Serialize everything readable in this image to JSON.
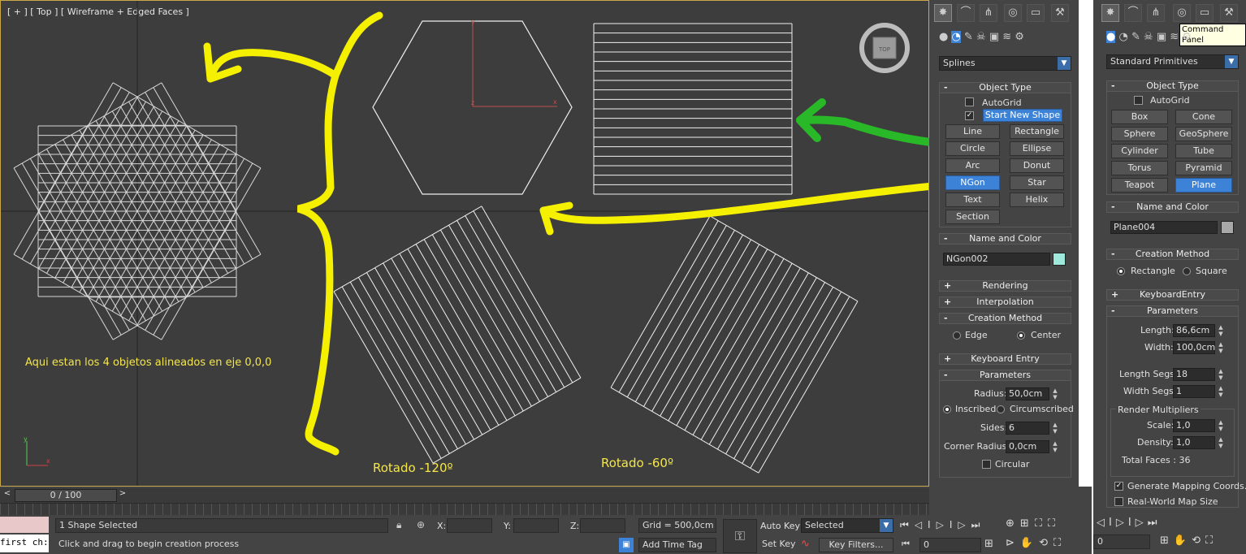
{
  "viewport": {
    "label": "[ + ] [ Top ] [ Wireframe + Edged Faces ]",
    "annotation_aligned": "Aqui estan los 4 objetos alineados en eje 0,0,0",
    "annotation_120": "Rotado -120º",
    "annotation_60": "Rotado -60º",
    "viewcube_label": "TOP",
    "axis_x": "x",
    "axis_y": "y",
    "pivot_x": "x",
    "pivot_y": "y",
    "pivot_z": "z"
  },
  "panel1": {
    "tool_icons": [
      "create-icon",
      "modify-icon",
      "hierarchy-icon",
      "motion-icon",
      "display-icon",
      "utilities-icon"
    ],
    "category_icons": [
      "geometry-icon",
      "shapes-icon",
      "lights-icon",
      "cameras-icon",
      "helpers-icon",
      "spacewarps-icon",
      "systems-icon"
    ],
    "category_dropdown": "Splines",
    "object_type": {
      "title": "Object Type",
      "autogrid": "AutoGrid",
      "start_new_shape": "Start New Shape",
      "buttons": [
        "Line",
        "Rectangle",
        "Circle",
        "Ellipse",
        "Arc",
        "Donut",
        "NGon",
        "Star",
        "Text",
        "Helix",
        "Section"
      ],
      "selected": "NGon"
    },
    "name_color": {
      "title": "Name and Color",
      "name": "NGon002",
      "color": "#9ee8dc"
    },
    "rendering": "Rendering",
    "interpolation": "Interpolation",
    "creation_method": {
      "title": "Creation Method",
      "edge": "Edge",
      "center": "Center"
    },
    "keyboard_entry": "Keyboard Entry",
    "parameters": {
      "title": "Parameters",
      "radius_label": "Radius:",
      "radius": "50,0cm",
      "inscribed": "Inscribed",
      "circumscribed": "Circumscribed",
      "sides_label": "Sides:",
      "sides": "6",
      "corner_label": "Corner Radius:",
      "corner": "0,0cm",
      "circular": "Circular"
    }
  },
  "panel2": {
    "tooltip": "Command Panel",
    "category_dropdown": "Standard Primitives",
    "object_type": {
      "title": "Object Type",
      "autogrid": "AutoGrid",
      "buttons": [
        "Box",
        "Cone",
        "Sphere",
        "GeoSphere",
        "Cylinder",
        "Tube",
        "Torus",
        "Pyramid",
        "Teapot",
        "Plane"
      ],
      "selected": "Plane"
    },
    "name_color": {
      "title": "Name and Color",
      "name": "Plane004",
      "color": "#a8a8a8"
    },
    "creation_method": {
      "title": "Creation Method",
      "rectangle": "Rectangle",
      "square": "Square"
    },
    "keyboard_entry": "KeyboardEntry",
    "parameters": {
      "title": "Parameters",
      "length_label": "Length:",
      "length": "86,6cm",
      "width_label": "Width:",
      "width": "100,0cm",
      "length_segs_label": "Length Segs:",
      "length_segs": "18",
      "width_segs_label": "Width Segs:",
      "width_segs": "1",
      "render_mult": "Render Multipliers",
      "scale_label": "Scale:",
      "scale": "1,0",
      "density_label": "Density:",
      "density": "1,0",
      "total_faces": "Total Faces : 36",
      "gen_mapping": "Generate Mapping Coords.",
      "real_world": "Real-World Map Size"
    }
  },
  "bottom": {
    "timeslider": "0 / 100",
    "selected_count": "1 Shape Selected",
    "prompt": "Click and drag to begin creation process",
    "script_text": "first ch:",
    "x_label": "X:",
    "y_label": "Y:",
    "z_label": "Z:",
    "grid": "Grid = 500,0cm",
    "add_time_tag": "Add Time Tag",
    "auto_key": "Auto Key",
    "set_key": "Set Key",
    "selected_dd": "Selected",
    "key_filters": "Key Filters...",
    "frame": "0",
    "frame2": "0"
  }
}
